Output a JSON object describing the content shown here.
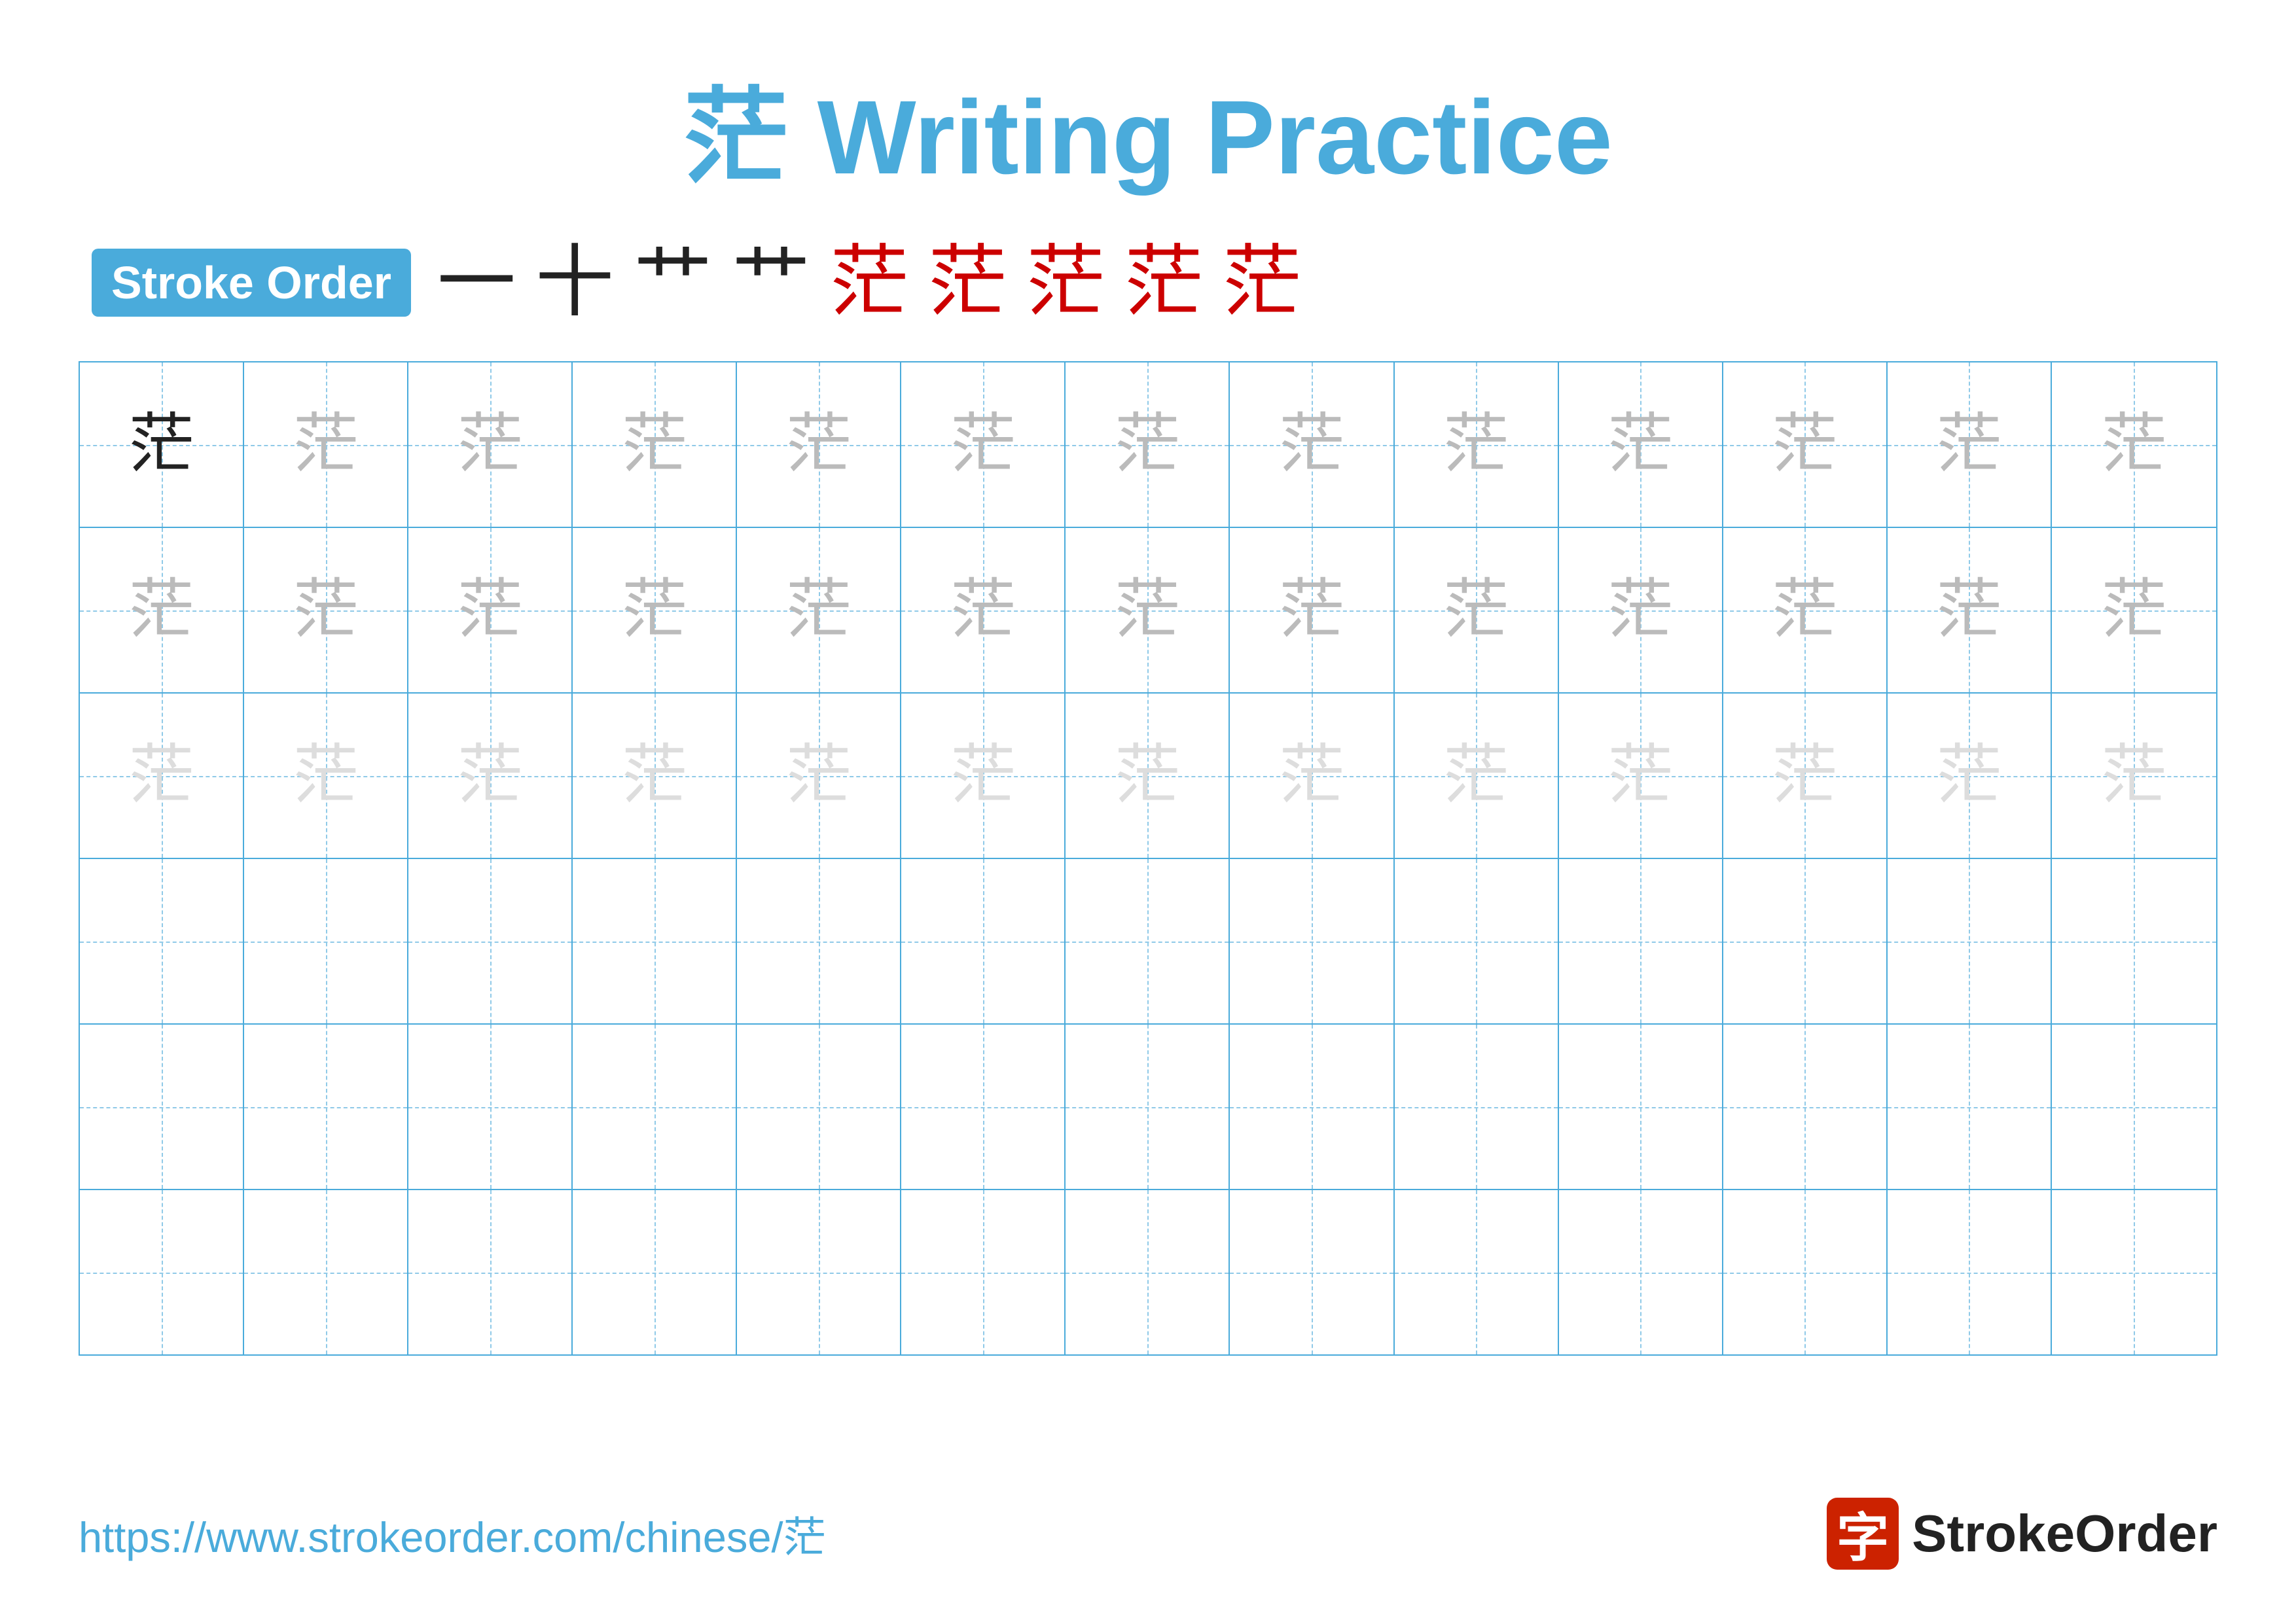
{
  "title": {
    "char": "茫",
    "text": "Writing Practice",
    "full": "茫 Writing Practice"
  },
  "stroke_order": {
    "badge_label": "Stroke Order",
    "strokes": [
      "一",
      "十",
      "艹",
      "艹",
      "茫",
      "茫",
      "茫",
      "茫",
      "茫"
    ]
  },
  "grid": {
    "rows": 6,
    "cols": 13,
    "char": "茫",
    "row_types": [
      "dark_then_medium",
      "medium",
      "light",
      "empty",
      "empty",
      "empty"
    ]
  },
  "footer": {
    "url": "https://www.strokeorder.com/chinese/茫",
    "logo_char": "字",
    "logo_text": "StrokeOrder"
  },
  "colors": {
    "accent": "#4AABDB",
    "dark_char": "#222222",
    "medium_char": "#bbbbbb",
    "light_char": "#cccccc",
    "lighter_char": "#dddddd",
    "guide_line": "#90CAE8",
    "border": "#4AABDB"
  }
}
